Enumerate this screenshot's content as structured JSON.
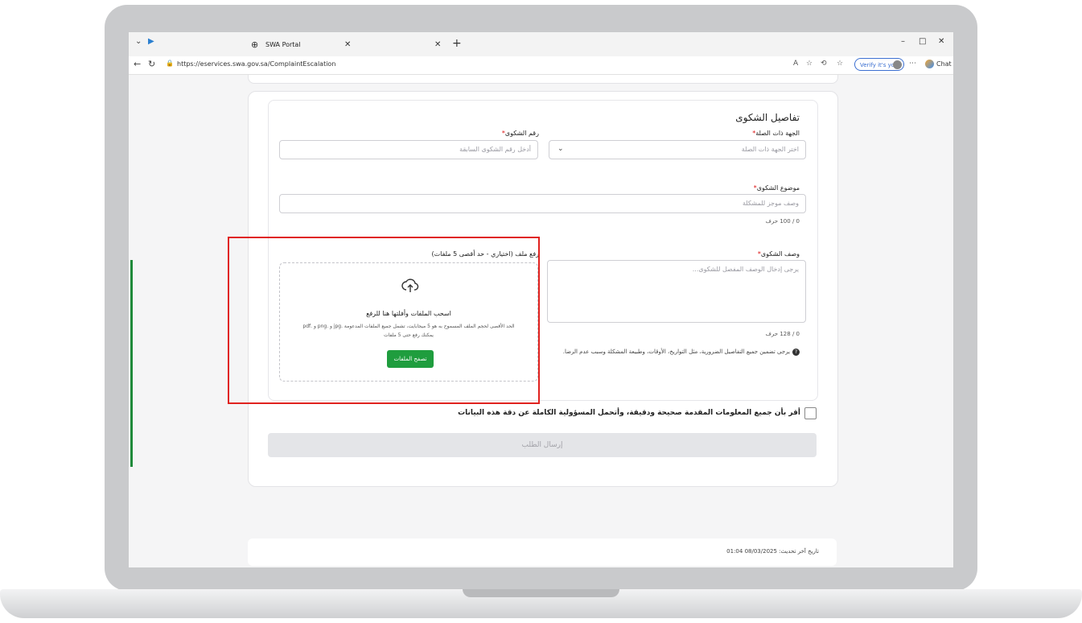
{
  "browser": {
    "tab_title": "SWA Portal",
    "url": "https://eservices.swa.gov.sa/ComplaintEscalation",
    "verify_label": "Verify it's you",
    "chat_label": "Chat"
  },
  "form": {
    "section_title": "تفاصيل الشكوى",
    "entity": {
      "label": "الجهة ذات الصلة",
      "placeholder": "اختر الجهة ذات الصلة"
    },
    "complaint_number": {
      "label": "رقم الشكوى",
      "placeholder": "أدخل رقم الشكوى السابقة"
    },
    "subject": {
      "label": "موضوع الشكوى",
      "placeholder": "وصف موجز للمشكلة",
      "counter": "0 / 100 حرف"
    },
    "description": {
      "label": "وصف الشكوى",
      "placeholder": "يرجى إدخال الوصف المفصل للشكوى...",
      "counter": "0 / 128 حرف",
      "hint": "يرجى تضمين جميع التفاصيل الضرورية، مثل التواريخ، الأوقات، وطبيعة المشكلة وسبب عدم الرضا."
    },
    "upload": {
      "label": "رفع ملف (اختياري - حد أقصى 5 ملفات)",
      "title": "اسحب الملفات وأفلتها هنا للرفع",
      "sub1": "الحد الأقصى لحجم الملف المسموح به هو 5 ميجابايت، تشمل جميع الملفات المدعومة .jpg و .png و .pdf",
      "sub2": "يمكنك رفع حتى 5 ملفات",
      "button": "تصفح الملفات"
    },
    "consent": "أقر بأن جميع المعلومات المقدمة صحيحة ودقيقة، وأتحمل المسؤولية الكاملة عن دقة هذه البيانات",
    "submit": "إرسال الطلب"
  },
  "footer": {
    "last_updated": "تاريخ آخر تحديث: 08/03/2025 01:04"
  },
  "colors": {
    "accent": "#1f9d3e",
    "highlight": "#e0221f",
    "footer_bar": "#0e5a2c"
  }
}
